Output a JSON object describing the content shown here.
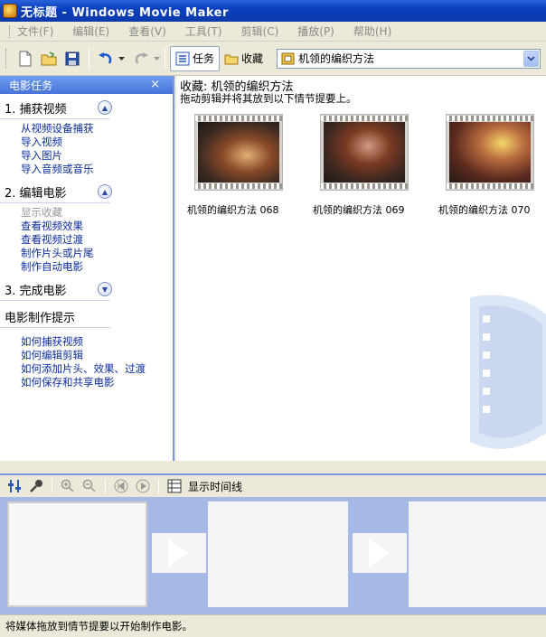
{
  "window": {
    "title": "无标题 - Windows Movie Maker"
  },
  "menu": [
    "文件(F)",
    "编辑(E)",
    "查看(V)",
    "工具(T)",
    "剪辑(C)",
    "播放(P)",
    "帮助(H)"
  ],
  "toolbar": {
    "tasks_label": "任务",
    "collections_label": "收藏",
    "collection_selected": "机领的编织方法"
  },
  "task_pane": {
    "header": "电影任务",
    "close": "×",
    "sections": [
      {
        "title": "1. 捕获视频",
        "expanded": true,
        "links": [
          {
            "label": "从视频设备捕获",
            "enabled": true
          },
          {
            "label": "导入视频",
            "enabled": true
          },
          {
            "label": "导入图片",
            "enabled": true
          },
          {
            "label": "导入音频或音乐",
            "enabled": true
          }
        ]
      },
      {
        "title": "2. 编辑电影",
        "expanded": true,
        "links": [
          {
            "label": "显示收藏",
            "enabled": false
          },
          {
            "label": "查看视频效果",
            "enabled": true
          },
          {
            "label": "查看视频过渡",
            "enabled": true
          },
          {
            "label": "制作片头或片尾",
            "enabled": true
          },
          {
            "label": "制作自动电影",
            "enabled": true
          }
        ]
      },
      {
        "title": "3. 完成电影",
        "expanded": false,
        "links": []
      },
      {
        "title": "电影制作提示",
        "expanded": true,
        "links": [
          {
            "label": "如何捕获视频",
            "enabled": true
          },
          {
            "label": "如何编辑剪辑",
            "enabled": true
          },
          {
            "label": "如何添加片头、效果、过渡",
            "enabled": true
          },
          {
            "label": "如何保存和共享电影",
            "enabled": true
          }
        ]
      }
    ]
  },
  "content": {
    "title": "收藏: 机领的编织方法",
    "hint": "拖动剪辑并将其放到以下情节提要上。",
    "clips": [
      {
        "caption": "机领的编织方法 068"
      },
      {
        "caption": "机领的编织方法 069"
      },
      {
        "caption": "机领的编织方法 070"
      }
    ]
  },
  "storyboard_toolbar": {
    "show_timeline_label": "显示时间线"
  },
  "status": {
    "text": "将媒体拖放到情节提要以开始制作电影。"
  },
  "colors": {
    "title_bar": "#0a3fbf",
    "pane_header": "#4873d9",
    "storyboard_bg": "#a6b8e6",
    "link": "#0b2d9c"
  }
}
